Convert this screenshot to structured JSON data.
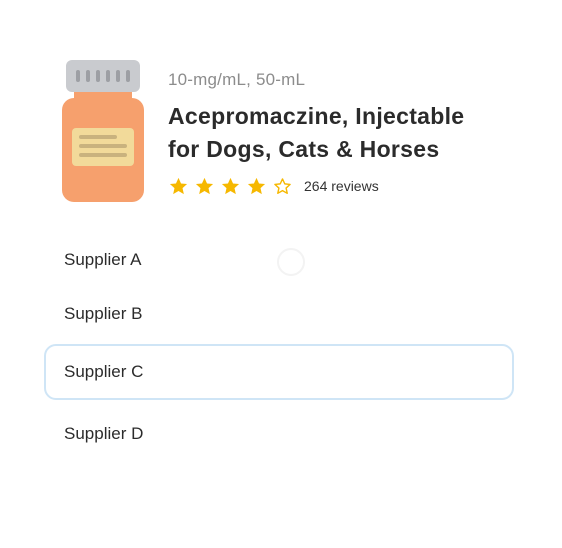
{
  "product": {
    "subtitle": "10-mg/mL, 50-mL",
    "title_line1": "Acepromaczine, Injectable",
    "title_line2": "for Dogs, Cats & Horses",
    "image_icon": "medicine-bottle-icon",
    "colors": {
      "cap": "#c9cbcf",
      "bottle": "#f6a06d",
      "label": "#f2da9a",
      "label_lines": "#c9b27e"
    }
  },
  "rating": {
    "value": 4,
    "max": 5,
    "reviews_text": "264 reviews",
    "star_color": "#f6b800"
  },
  "suppliers": {
    "items": [
      {
        "label": "Supplier A",
        "selected": false
      },
      {
        "label": "Supplier B",
        "selected": false
      },
      {
        "label": "Supplier C",
        "selected": true
      },
      {
        "label": "Supplier D",
        "selected": false
      }
    ],
    "selected_border_color": "#cfe5f6"
  }
}
